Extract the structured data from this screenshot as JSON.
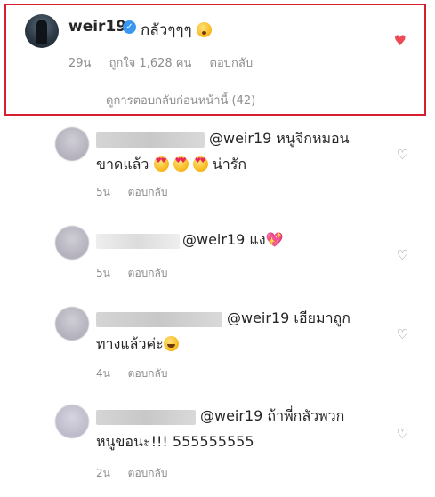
{
  "main_comment": {
    "username": "weir19",
    "text": "กลัวๆๆๆ",
    "time": "29น",
    "likes": "ถูกใจ 1,628 คน",
    "reply_label": "ตอบกลับ",
    "view_previous_replies": "ดูการตอบกลับก่อนหน้านี้ (42)",
    "liked": true
  },
  "replies": [
    {
      "mention": "@weir19",
      "text_line1": "หนูจิกหมอน",
      "text_line2": "ขาดแล้ว",
      "text_line2_suffix": "น่ารัก",
      "time": "5น",
      "reply_label": "ตอบกลับ"
    },
    {
      "mention": "@weir19",
      "text_line1": "แง",
      "time": "5น",
      "reply_label": "ตอบกลับ"
    },
    {
      "mention": "@weir19",
      "text_line1": "เฮียมาถูก",
      "text_line2": "ทางแล้วค่ะ",
      "time": "4น",
      "reply_label": "ตอบกลับ"
    },
    {
      "mention": "@weir19",
      "text_line1": "ถ้าพี่กลัวพวก",
      "text_line2": "หนูขอนะ!!! 555555555",
      "time": "2น",
      "reply_label": "ตอบกลับ"
    }
  ],
  "icons": {
    "verified": "verified-badge-icon",
    "like_filled": "heart-filled-icon",
    "like_outline": "heart-outline-icon"
  },
  "colors": {
    "highlight_border": "#d6202f",
    "like_red": "#ed4956",
    "verified_blue": "#3897f0",
    "muted_text": "#8e8e8e"
  }
}
